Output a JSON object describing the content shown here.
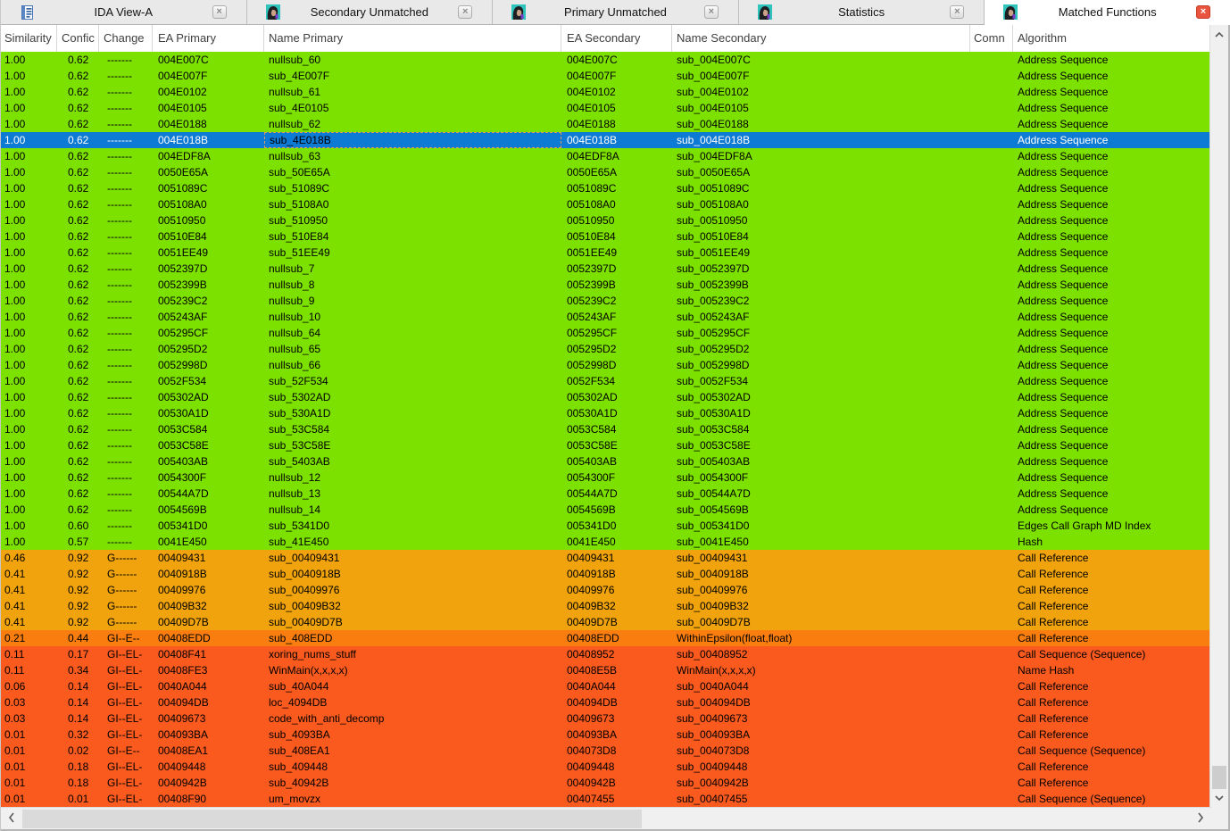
{
  "tabs": [
    {
      "label": "IDA View-A",
      "icon": "ida-view",
      "active": false
    },
    {
      "label": "Secondary Unmatched",
      "icon": "diaphora",
      "active": false
    },
    {
      "label": "Primary Unmatched",
      "icon": "diaphora",
      "active": false
    },
    {
      "label": "Statistics",
      "icon": "diaphora",
      "active": false
    },
    {
      "label": "Matched Functions",
      "icon": "diaphora",
      "active": true
    }
  ],
  "tab_close_label": "×",
  "colors": {
    "green": "#7DE100",
    "orange": "#F0A30C",
    "deep_orange": "#FA7E0F",
    "red_orange": "#FB5A1E",
    "selected": "#0D7AD4"
  },
  "table": {
    "columns": [
      {
        "key": "similarity",
        "label": "Similarity"
      },
      {
        "key": "confidence",
        "label": "Confic"
      },
      {
        "key": "change",
        "label": "Change"
      },
      {
        "key": "ea-primary",
        "label": "EA Primary"
      },
      {
        "key": "name-primary",
        "label": "Name Primary"
      },
      {
        "key": "ea-secondary",
        "label": "EA Secondary"
      },
      {
        "key": "name-secondary",
        "label": "Name Secondary"
      },
      {
        "key": "comment",
        "label": "Comn"
      },
      {
        "key": "algorithm",
        "label": "Algorithm"
      }
    ],
    "rows": [
      {
        "cells": [
          "1.00",
          "0.62",
          "-------",
          "004E007C",
          "nullsub_60",
          "004E007C",
          "sub_004E007C",
          "",
          "Address Sequence"
        ],
        "tone": "green"
      },
      {
        "cells": [
          "1.00",
          "0.62",
          "-------",
          "004E007F",
          "sub_4E007F",
          "004E007F",
          "sub_004E007F",
          "",
          "Address Sequence"
        ],
        "tone": "green"
      },
      {
        "cells": [
          "1.00",
          "0.62",
          "-------",
          "004E0102",
          "nullsub_61",
          "004E0102",
          "sub_004E0102",
          "",
          "Address Sequence"
        ],
        "tone": "green"
      },
      {
        "cells": [
          "1.00",
          "0.62",
          "-------",
          "004E0105",
          "sub_4E0105",
          "004E0105",
          "sub_004E0105",
          "",
          "Address Sequence"
        ],
        "tone": "green"
      },
      {
        "cells": [
          "1.00",
          "0.62",
          "-------",
          "004E0188",
          "nullsub_62",
          "004E0188",
          "sub_004E0188",
          "",
          "Address Sequence"
        ],
        "tone": "green"
      },
      {
        "cells": [
          "1.00",
          "0.62",
          "-------",
          "004E018B",
          "sub_4E018B",
          "004E018B",
          "sub_004E018B",
          "",
          "Address Sequence"
        ],
        "tone": "green",
        "selected": true
      },
      {
        "cells": [
          "1.00",
          "0.62",
          "-------",
          "004EDF8A",
          "nullsub_63",
          "004EDF8A",
          "sub_004EDF8A",
          "",
          "Address Sequence"
        ],
        "tone": "green"
      },
      {
        "cells": [
          "1.00",
          "0.62",
          "-------",
          "0050E65A",
          "sub_50E65A",
          "0050E65A",
          "sub_0050E65A",
          "",
          "Address Sequence"
        ],
        "tone": "green"
      },
      {
        "cells": [
          "1.00",
          "0.62",
          "-------",
          "0051089C",
          "sub_51089C",
          "0051089C",
          "sub_0051089C",
          "",
          "Address Sequence"
        ],
        "tone": "green"
      },
      {
        "cells": [
          "1.00",
          "0.62",
          "-------",
          "005108A0",
          "sub_5108A0",
          "005108A0",
          "sub_005108A0",
          "",
          "Address Sequence"
        ],
        "tone": "green"
      },
      {
        "cells": [
          "1.00",
          "0.62",
          "-------",
          "00510950",
          "sub_510950",
          "00510950",
          "sub_00510950",
          "",
          "Address Sequence"
        ],
        "tone": "green"
      },
      {
        "cells": [
          "1.00",
          "0.62",
          "-------",
          "00510E84",
          "sub_510E84",
          "00510E84",
          "sub_00510E84",
          "",
          "Address Sequence"
        ],
        "tone": "green"
      },
      {
        "cells": [
          "1.00",
          "0.62",
          "-------",
          "0051EE49",
          "sub_51EE49",
          "0051EE49",
          "sub_0051EE49",
          "",
          "Address Sequence"
        ],
        "tone": "green"
      },
      {
        "cells": [
          "1.00",
          "0.62",
          "-------",
          "0052397D",
          "nullsub_7",
          "0052397D",
          "sub_0052397D",
          "",
          "Address Sequence"
        ],
        "tone": "green"
      },
      {
        "cells": [
          "1.00",
          "0.62",
          "-------",
          "0052399B",
          "nullsub_8",
          "0052399B",
          "sub_0052399B",
          "",
          "Address Sequence"
        ],
        "tone": "green"
      },
      {
        "cells": [
          "1.00",
          "0.62",
          "-------",
          "005239C2",
          "nullsub_9",
          "005239C2",
          "sub_005239C2",
          "",
          "Address Sequence"
        ],
        "tone": "green"
      },
      {
        "cells": [
          "1.00",
          "0.62",
          "-------",
          "005243AF",
          "nullsub_10",
          "005243AF",
          "sub_005243AF",
          "",
          "Address Sequence"
        ],
        "tone": "green"
      },
      {
        "cells": [
          "1.00",
          "0.62",
          "-------",
          "005295CF",
          "nullsub_64",
          "005295CF",
          "sub_005295CF",
          "",
          "Address Sequence"
        ],
        "tone": "green"
      },
      {
        "cells": [
          "1.00",
          "0.62",
          "-------",
          "005295D2",
          "nullsub_65",
          "005295D2",
          "sub_005295D2",
          "",
          "Address Sequence"
        ],
        "tone": "green"
      },
      {
        "cells": [
          "1.00",
          "0.62",
          "-------",
          "0052998D",
          "nullsub_66",
          "0052998D",
          "sub_0052998D",
          "",
          "Address Sequence"
        ],
        "tone": "green"
      },
      {
        "cells": [
          "1.00",
          "0.62",
          "-------",
          "0052F534",
          "sub_52F534",
          "0052F534",
          "sub_0052F534",
          "",
          "Address Sequence"
        ],
        "tone": "green"
      },
      {
        "cells": [
          "1.00",
          "0.62",
          "-------",
          "005302AD",
          "sub_5302AD",
          "005302AD",
          "sub_005302AD",
          "",
          "Address Sequence"
        ],
        "tone": "green"
      },
      {
        "cells": [
          "1.00",
          "0.62",
          "-------",
          "00530A1D",
          "sub_530A1D",
          "00530A1D",
          "sub_00530A1D",
          "",
          "Address Sequence"
        ],
        "tone": "green"
      },
      {
        "cells": [
          "1.00",
          "0.62",
          "-------",
          "0053C584",
          "sub_53C584",
          "0053C584",
          "sub_0053C584",
          "",
          "Address Sequence"
        ],
        "tone": "green"
      },
      {
        "cells": [
          "1.00",
          "0.62",
          "-------",
          "0053C58E",
          "sub_53C58E",
          "0053C58E",
          "sub_0053C58E",
          "",
          "Address Sequence"
        ],
        "tone": "green"
      },
      {
        "cells": [
          "1.00",
          "0.62",
          "-------",
          "005403AB",
          "sub_5403AB",
          "005403AB",
          "sub_005403AB",
          "",
          "Address Sequence"
        ],
        "tone": "green"
      },
      {
        "cells": [
          "1.00",
          "0.62",
          "-------",
          "0054300F",
          "nullsub_12",
          "0054300F",
          "sub_0054300F",
          "",
          "Address Sequence"
        ],
        "tone": "green"
      },
      {
        "cells": [
          "1.00",
          "0.62",
          "-------",
          "00544A7D",
          "nullsub_13",
          "00544A7D",
          "sub_00544A7D",
          "",
          "Address Sequence"
        ],
        "tone": "green"
      },
      {
        "cells": [
          "1.00",
          "0.62",
          "-------",
          "0054569B",
          "nullsub_14",
          "0054569B",
          "sub_0054569B",
          "",
          "Address Sequence"
        ],
        "tone": "green"
      },
      {
        "cells": [
          "1.00",
          "0.60",
          "-------",
          "005341D0",
          "sub_5341D0",
          "005341D0",
          "sub_005341D0",
          "",
          "Edges Call Graph MD Index"
        ],
        "tone": "green"
      },
      {
        "cells": [
          "1.00",
          "0.57",
          "-------",
          "0041E450",
          "sub_41E450",
          "0041E450",
          "sub_0041E450",
          "",
          "Hash"
        ],
        "tone": "green"
      },
      {
        "cells": [
          "0.46",
          "0.92",
          "G------",
          "00409431",
          "sub_00409431",
          "00409431",
          "sub_00409431",
          "",
          "Call Reference"
        ],
        "tone": "orange"
      },
      {
        "cells": [
          "0.41",
          "0.92",
          "G------",
          "0040918B",
          "sub_0040918B",
          "0040918B",
          "sub_0040918B",
          "",
          "Call Reference"
        ],
        "tone": "orange"
      },
      {
        "cells": [
          "0.41",
          "0.92",
          "G------",
          "00409976",
          "sub_00409976",
          "00409976",
          "sub_00409976",
          "",
          "Call Reference"
        ],
        "tone": "orange"
      },
      {
        "cells": [
          "0.41",
          "0.92",
          "G------",
          "00409B32",
          "sub_00409B32",
          "00409B32",
          "sub_00409B32",
          "",
          "Call Reference"
        ],
        "tone": "orange"
      },
      {
        "cells": [
          "0.41",
          "0.92",
          "G------",
          "00409D7B",
          "sub_00409D7B",
          "00409D7B",
          "sub_00409D7B",
          "",
          "Call Reference"
        ],
        "tone": "orange"
      },
      {
        "cells": [
          "0.21",
          "0.44",
          "GI--E--",
          "00408EDD",
          "sub_408EDD",
          "00408EDD",
          "WithinEpsilon(float,float)",
          "",
          "Call Reference"
        ],
        "tone": "deep_orange"
      },
      {
        "cells": [
          "0.11",
          "0.17",
          "GI--EL-",
          "00408F41",
          "xoring_nums_stuff",
          "00408952",
          "sub_00408952",
          "",
          "Call Sequence (Sequence)"
        ],
        "tone": "red_orange"
      },
      {
        "cells": [
          "0.11",
          "0.34",
          "GI--EL-",
          "00408FE3",
          "WinMain(x,x,x,x)",
          "00408E5B",
          "WinMain(x,x,x,x)",
          "",
          "Name Hash"
        ],
        "tone": "red_orange"
      },
      {
        "cells": [
          "0.06",
          "0.14",
          "GI--EL-",
          "0040A044",
          "sub_40A044",
          "0040A044",
          "sub_0040A044",
          "",
          "Call Reference"
        ],
        "tone": "red_orange"
      },
      {
        "cells": [
          "0.03",
          "0.14",
          "GI--EL-",
          "004094DB",
          "loc_4094DB",
          "004094DB",
          "sub_004094DB",
          "",
          "Call Reference"
        ],
        "tone": "red_orange"
      },
      {
        "cells": [
          "0.03",
          "0.14",
          "GI--EL-",
          "00409673",
          "code_with_anti_decomp",
          "00409673",
          "sub_00409673",
          "",
          "Call Reference"
        ],
        "tone": "red_orange"
      },
      {
        "cells": [
          "0.01",
          "0.32",
          "GI--EL-",
          "004093BA",
          "sub_4093BA",
          "004093BA",
          "sub_004093BA",
          "",
          "Call Reference"
        ],
        "tone": "red_orange"
      },
      {
        "cells": [
          "0.01",
          "0.02",
          "GI--E--",
          "00408EA1",
          "sub_408EA1",
          "004073D8",
          "sub_004073D8",
          "",
          "Call Sequence (Sequence)"
        ],
        "tone": "red_orange"
      },
      {
        "cells": [
          "0.01",
          "0.18",
          "GI--EL-",
          "00409448",
          "sub_409448",
          "00409448",
          "sub_00409448",
          "",
          "Call Reference"
        ],
        "tone": "red_orange"
      },
      {
        "cells": [
          "0.01",
          "0.18",
          "GI--EL-",
          "0040942B",
          "sub_40942B",
          "0040942B",
          "sub_0040942B",
          "",
          "Call Reference"
        ],
        "tone": "red_orange"
      },
      {
        "cells": [
          "0.01",
          "0.01",
          "GI--EL-",
          "00408F90",
          "um_movzx",
          "00407455",
          "sub_00407455",
          "",
          "Call Sequence (Sequence)"
        ],
        "tone": "red_orange"
      }
    ]
  }
}
